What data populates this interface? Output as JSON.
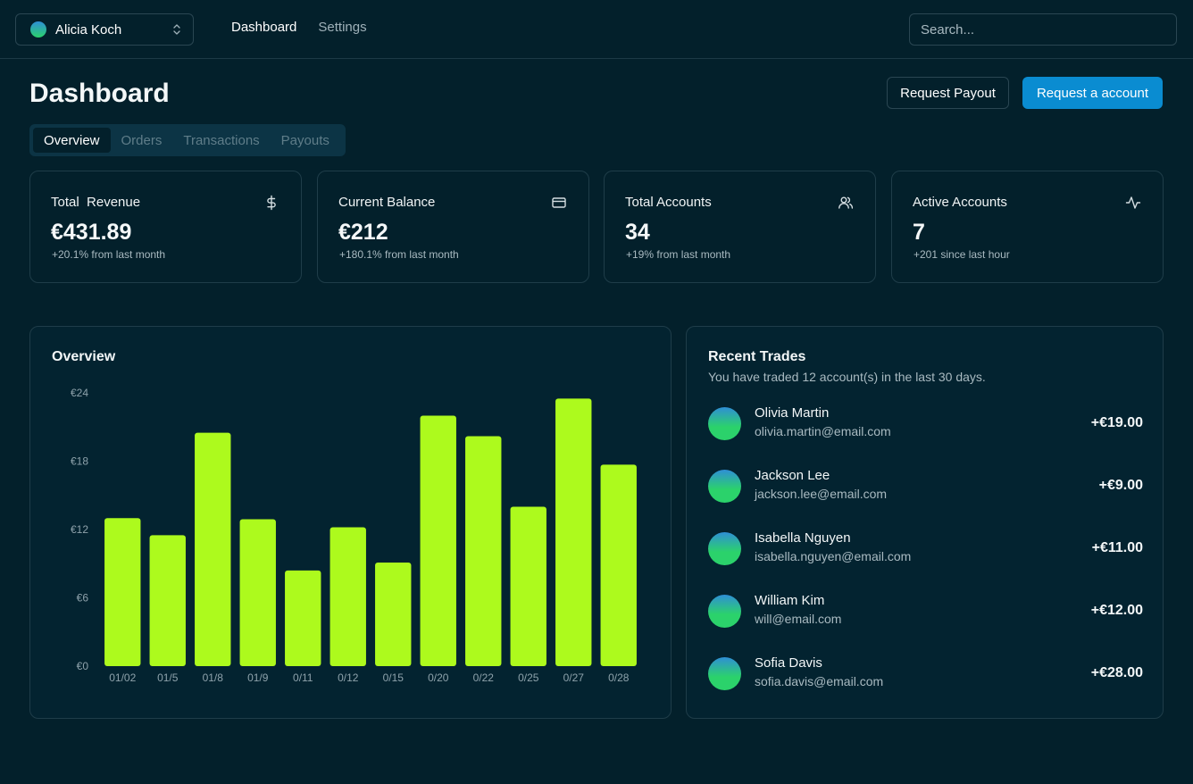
{
  "header": {
    "account_name": "Alicia Koch",
    "nav": [
      {
        "label": "Dashboard",
        "active": true
      },
      {
        "label": "Settings",
        "active": false
      }
    ],
    "search_placeholder": "Search..."
  },
  "page": {
    "title": "Dashboard",
    "request_payout_label": "Request Payout",
    "request_account_label": "Request a account",
    "tabs": [
      "Overview",
      "Orders",
      "Transactions",
      "Payouts"
    ],
    "active_tab": "Overview"
  },
  "stats": [
    {
      "label": "Total  Revenue",
      "value": "€431.89",
      "sub": "+20.1% from last month",
      "icon": "dollar-icon"
    },
    {
      "label": "Current Balance",
      "value": "€212",
      "sub": "+180.1% from last month",
      "icon": "credit-card-icon"
    },
    {
      "label": "Total Accounts",
      "value": "34",
      "sub": "+19% from last month",
      "icon": "users-icon"
    },
    {
      "label": "Active Accounts",
      "value": "7",
      "sub": "+201 since last hour",
      "icon": "activity-icon"
    }
  ],
  "overview": {
    "title": "Overview"
  },
  "chart_data": {
    "type": "bar",
    "categories": [
      "01/02",
      "01/5",
      "01/8",
      "01/9",
      "0/11",
      "0/12",
      "0/15",
      "0/20",
      "0/22",
      "0/25",
      "0/27",
      "0/28"
    ],
    "values": [
      13,
      11.5,
      20.5,
      12.9,
      8.4,
      12.2,
      9.1,
      22,
      20.2,
      14,
      23.5,
      17.7
    ],
    "yticks": [
      "€0",
      "€6",
      "€12",
      "€18",
      "€24"
    ],
    "ytick_values": [
      0,
      6,
      12,
      18,
      24
    ],
    "ylim": [
      0,
      24
    ],
    "grid": false,
    "bar_color": "#adfa1d"
  },
  "trades": {
    "title": "Recent Trades",
    "subtitle": "You have traded 12 account(s) in the last 30 days.",
    "items": [
      {
        "name": "Olivia Martin",
        "email": "olivia.martin@email.com",
        "amount": "+€19.00"
      },
      {
        "name": "Jackson Lee",
        "email": "jackson.lee@email.com",
        "amount": "+€9.00"
      },
      {
        "name": "Isabella Nguyen",
        "email": "isabella.nguyen@email.com",
        "amount": "+€11.00"
      },
      {
        "name": "William Kim",
        "email": "will@email.com",
        "amount": "+€12.00"
      },
      {
        "name": "Sofia Davis",
        "email": "sofia.davis@email.com",
        "amount": "+€28.00"
      }
    ]
  },
  "colors": {
    "background": "#03202b",
    "primary": "#0a8cd1",
    "bar": "#adfa1d"
  }
}
